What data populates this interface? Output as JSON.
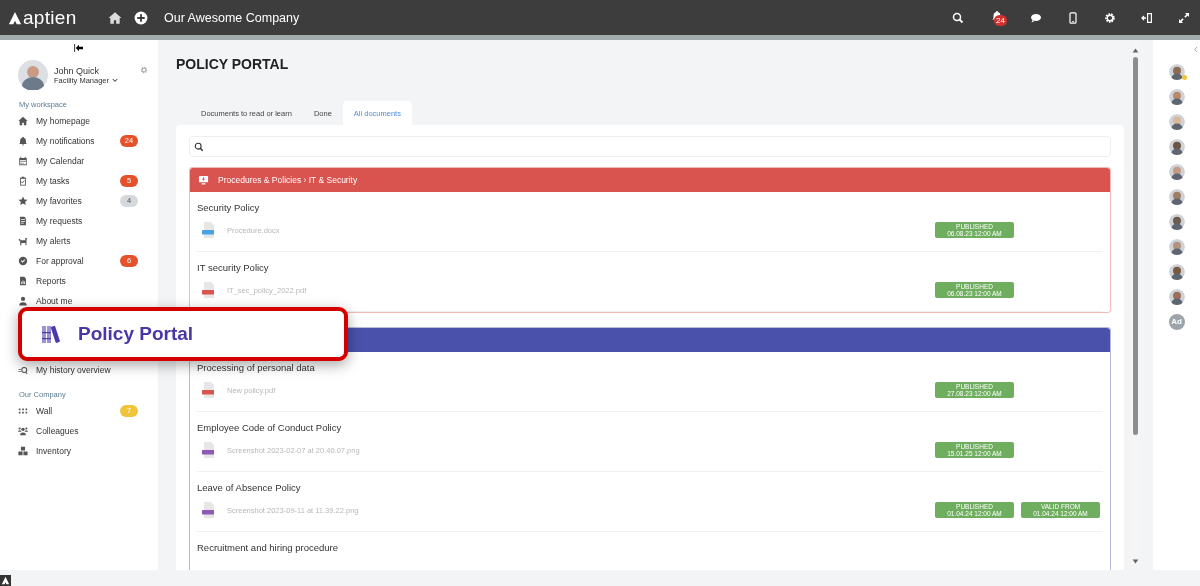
{
  "topbar": {
    "logo": "aptien",
    "company": "Our Awesome Company",
    "notification_count": "24"
  },
  "profile": {
    "name": "John Quick",
    "role": "Facility Manager"
  },
  "sidebar": {
    "sections": [
      {
        "heading": "My workspace",
        "items": [
          {
            "label": "My homepage"
          },
          {
            "label": "My notifications",
            "badge": {
              "text": "24",
              "color": "#e4512b"
            }
          },
          {
            "label": "My Calendar"
          },
          {
            "label": "My tasks",
            "badge": {
              "text": "5",
              "color": "#e4512b"
            }
          },
          {
            "label": "My favorites",
            "badge": {
              "text": "4",
              "color": "#d5d9dc"
            }
          },
          {
            "label": "My requests"
          },
          {
            "label": "My alerts"
          },
          {
            "label": "For approval",
            "badge": {
              "text": "6",
              "color": "#e4512b"
            }
          },
          {
            "label": "Reports"
          },
          {
            "label": "About me"
          }
        ]
      },
      {
        "items": [
          {
            "label": "My history overview"
          }
        ]
      },
      {
        "heading": "Our Company",
        "items": [
          {
            "label": "Wall",
            "badge": {
              "text": "7",
              "color": "#f0c53c"
            }
          },
          {
            "label": "Colleagues"
          },
          {
            "label": "Inventory"
          }
        ]
      }
    ]
  },
  "callout": {
    "label": "Policy Portal"
  },
  "page": {
    "title": "POLICY PORTAL",
    "tabs": [
      {
        "label": "Documents to read or learn",
        "selected": false
      },
      {
        "label": "Done",
        "selected": false
      },
      {
        "label": "All documents",
        "selected": true
      }
    ],
    "groups": [
      {
        "title": "Procedures & Policies › IT & Security",
        "color": "#d9534f",
        "documents": [
          {
            "title": "Security Policy",
            "file": {
              "name": "Procedure.docx",
              "kind": "doc"
            },
            "badges": [
              {
                "label": "PUBLISHED",
                "date": "06.08.23 12:00 AM"
              }
            ]
          },
          {
            "title": "IT security Policy",
            "file": {
              "name": "IT_sec_policy_2022.pdf",
              "kind": "pdf"
            },
            "badges": [
              {
                "label": "PUBLISHED",
                "date": "06.08.23 12:00 AM"
              }
            ]
          }
        ]
      },
      {
        "color": "#4a51aa",
        "documents": [
          {
            "title": "Processing of personal data",
            "file": {
              "name": "New policy.pdf",
              "kind": "pdf"
            },
            "badges": [
              {
                "label": "PUBLISHED",
                "date": "27.08.23 12:00 AM"
              }
            ]
          },
          {
            "title": "Employee Code of Conduct Policy",
            "file": {
              "name": "Screenshot 2023-02-07 at 20.40.07.png",
              "kind": "png"
            },
            "badges": [
              {
                "label": "PUBLISHED",
                "date": "15.01.25 12:00 AM"
              }
            ]
          },
          {
            "title": "Leave of Absence Policy",
            "file": {
              "name": "Screenshot 2023-09-11 at 11.39.22.png",
              "kind": "png"
            },
            "badges": [
              {
                "label": "PUBLISHED",
                "date": "01.04.24 12:00 AM"
              },
              {
                "label": "VALID FROM",
                "date": "01.04.24 12:00 AM"
              }
            ]
          },
          {
            "title": "Recruitment and hiring procedure"
          }
        ]
      }
    ]
  },
  "people": [
    {
      "online": true
    },
    {
      "online": false
    },
    {
      "online": false
    },
    {
      "online": false
    },
    {
      "online": false
    },
    {
      "online": false
    },
    {
      "online": false
    },
    {
      "online": false
    },
    {
      "online": false
    },
    {
      "online": false
    },
    {
      "initials": "Ad",
      "online": false
    }
  ]
}
